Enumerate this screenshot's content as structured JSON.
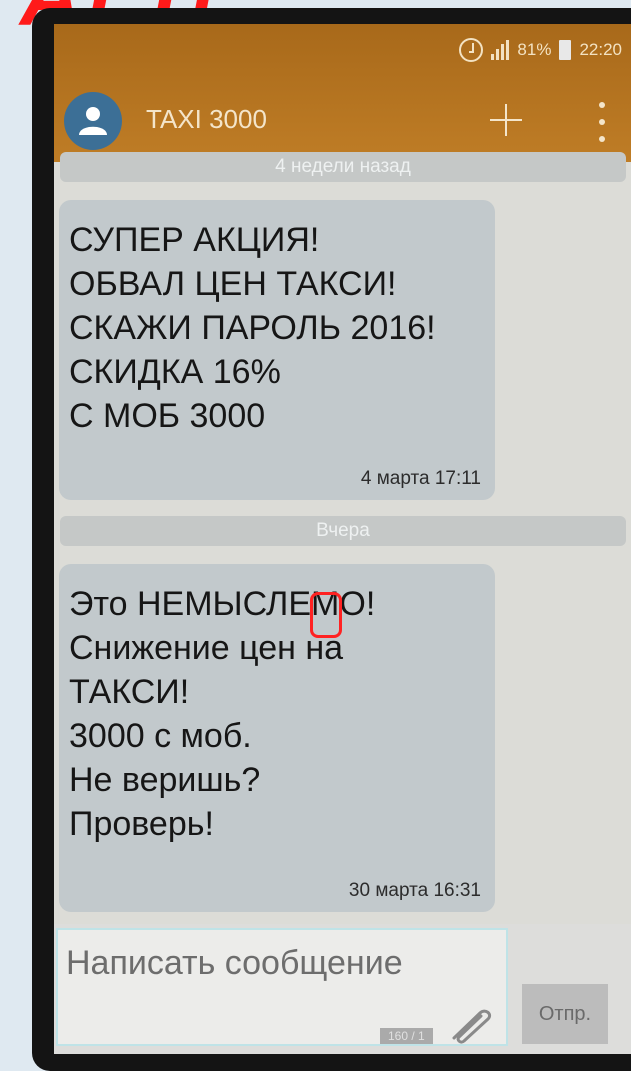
{
  "header_overlay": "АТ Н",
  "status_bar": {
    "battery": "81%",
    "time": "22:20"
  },
  "conversation": {
    "title": "TAXI 3000"
  },
  "dividers": [
    "4 недели назад",
    "Вчера"
  ],
  "messages": [
    {
      "text": "СУПЕР АКЦИЯ!\nОБВАЛ ЦЕН ТАКСИ!\nСКАЖИ ПАРОЛЬ 2016!\nСКИДКА 16%\nС МОБ 3000",
      "time": "4 марта 17:11"
    },
    {
      "text": "Это НЕМЫСЛЕМО!\nСнижение цен на\nТАКСИ!\n3000 с моб.\nНе веришь?\nПроверь!",
      "time": "30 марта 16:31"
    }
  ],
  "composer": {
    "placeholder": "Написать сообщение",
    "counter": "160 / 1",
    "send_label": "Отпр."
  },
  "icons": [
    "alarm-icon",
    "signal-icon",
    "battery-icon",
    "contact-avatar-icon",
    "plus-icon",
    "overflow-menu-icon",
    "paperclip-icon"
  ],
  "colors": {
    "app_bar": "#b37424",
    "bubble": "#c2c9cc",
    "highlight": "#ff2222"
  }
}
